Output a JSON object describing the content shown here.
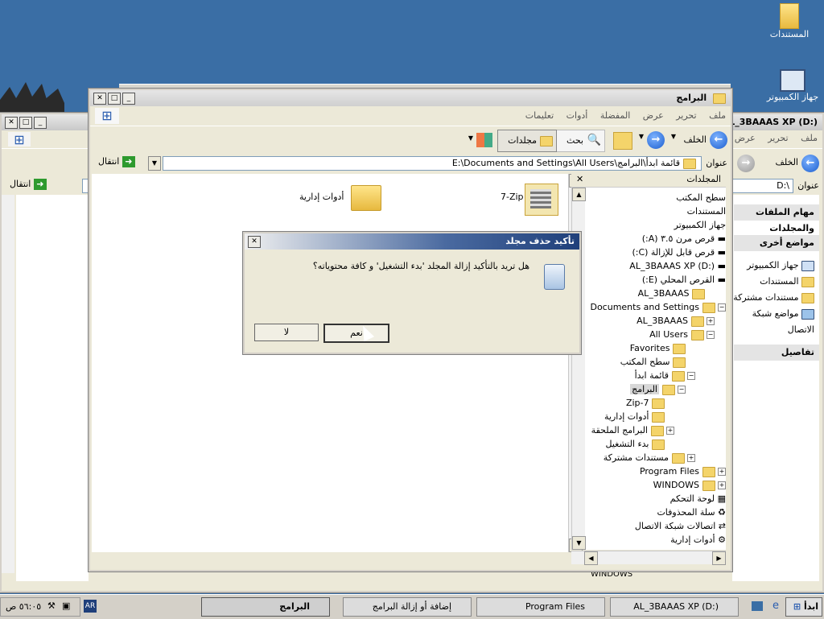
{
  "desktop": {
    "icons": [
      {
        "label": "المستندات",
        "icon": "my-documents-icon"
      },
      {
        "label": "جهاز الكمبيوتر",
        "icon": "my-computer-icon"
      }
    ]
  },
  "back_window": {
    "title": "AL_3BAAAS XP (D:)",
    "menu": [
      "ملف",
      "تحرير",
      "عرض"
    ],
    "back_label": "الخلف",
    "address_label": "عنوان",
    "address_value": "D:\\",
    "go_label": "انتقال",
    "side_sections": [
      {
        "title": "مهام الملفات والمجلدات"
      },
      {
        "title": "مواضع أخرى",
        "items": [
          "جهاز الكمبيوتر",
          "المستندات",
          "مستندات مشتركة",
          "مواضع شبكة الاتصال"
        ]
      },
      {
        "title": "تفاصيل"
      }
    ],
    "bottom_text": "WINDOWS"
  },
  "main_window": {
    "title": "البرامج",
    "menu": [
      "ملف",
      "تحرير",
      "عرض",
      "المفضلة",
      "أدوات",
      "تعليمات"
    ],
    "toolbar": {
      "back": "الخلف",
      "search": "بحث",
      "folders": "مجلدات"
    },
    "address_label": "عنوان",
    "address_value": "E:\\Documents and Settings\\All Users\\قائمة ابدأ\\البرامج",
    "go_label": "انتقال",
    "folders_pane_title": "المجلدات",
    "content_items": [
      {
        "label": "7-Zip"
      },
      {
        "label": "أدوات إدارية"
      }
    ],
    "tree": [
      {
        "label": "سطح المكتب"
      },
      {
        "label": "المستندات"
      },
      {
        "label": "جهاز الكمبيوتر"
      },
      {
        "label": "قرص مرن ٣.٥ (A:)"
      },
      {
        "label": "قرص قابل للإزالة (C:)"
      },
      {
        "label": "AL_3BAAAS XP (D:)"
      },
      {
        "label": "القرص المحلي (E:)"
      },
      {
        "label": "AL_3BAAAS"
      },
      {
        "label": "Documents and Settings"
      },
      {
        "label": "AL_3BAAAS"
      },
      {
        "label": "All Users"
      },
      {
        "label": "Favorites"
      },
      {
        "label": "سطح المكتب"
      },
      {
        "label": "قائمة ابدأ"
      },
      {
        "label": "البرامج"
      },
      {
        "label": "7-Zip"
      },
      {
        "label": "أدوات إدارية"
      },
      {
        "label": "البرامج الملحقة"
      },
      {
        "label": "بدء التشغيل"
      },
      {
        "label": "مستندات مشتركة"
      },
      {
        "label": "Program Files"
      },
      {
        "label": "WINDOWS"
      },
      {
        "label": "لوحة التحكم"
      },
      {
        "label": "سلة المحذوفات"
      },
      {
        "label": "اتصالات شبكة الاتصال"
      },
      {
        "label": "أدوات إدارية"
      }
    ]
  },
  "dialog": {
    "title": "تأكيد حذف مجلد",
    "message": "هل تريد بالتأكيد إزالة المجلد 'بدء التشغيل' و كافة محتوياته؟",
    "yes_label": "نعم",
    "no_label": "لا"
  },
  "taskbar": {
    "start_label": "ابدأ",
    "buttons": [
      "AL_3BAAAS XP (D:)",
      "Program Files",
      "إضافة أو إزالة البرامج",
      "البرامج"
    ],
    "lang": "AR",
    "clock": "٥٦:٠٥ ص"
  }
}
